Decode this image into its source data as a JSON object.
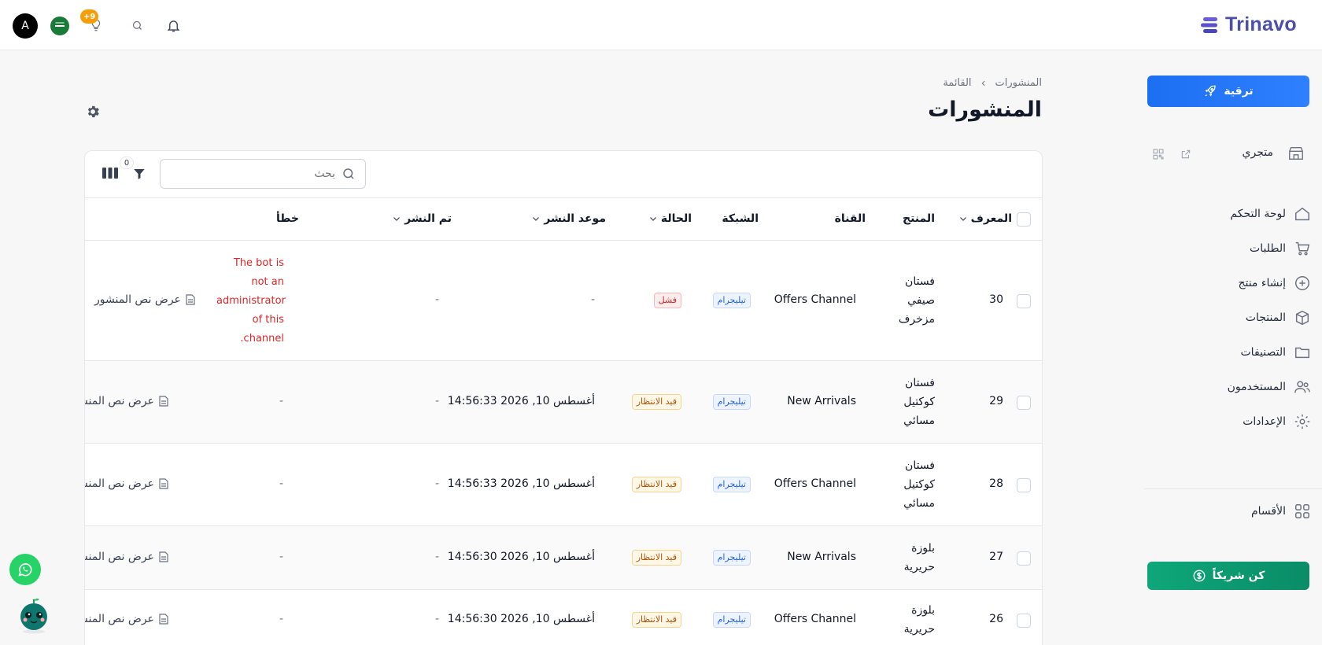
{
  "topbar": {
    "avatar_letter": "A",
    "notif_count": "+9",
    "logo_text": "Trinavo"
  },
  "sidebar": {
    "upgrade_label": "ترقية",
    "store_label": "متجري",
    "items": [
      {
        "label": "لوحة التحكم",
        "icon": "home-icon"
      },
      {
        "label": "الطلبات",
        "icon": "cart-icon"
      },
      {
        "label": "إنشاء منتج",
        "icon": "plus-circle-icon"
      },
      {
        "label": "المنتجات",
        "icon": "box-icon"
      },
      {
        "label": "التصنيفات",
        "icon": "folder-icon"
      },
      {
        "label": "المستخدمون",
        "icon": "users-icon"
      },
      {
        "label": "الإعدادات",
        "icon": "gear-icon"
      }
    ],
    "sections_label": "الأقسام",
    "partner_label": "كن شريكاً"
  },
  "header": {
    "breadcrumb": [
      "المنشورات",
      "القائمة"
    ],
    "title": "المنشورات"
  },
  "toolbar": {
    "search_placeholder": "بحث",
    "filter_count": "0"
  },
  "table": {
    "columns": {
      "id": "المعرف",
      "product": "المنتج",
      "channel": "القناة",
      "network": "الشبكة",
      "status": "الحالة",
      "scheduled": "موعد النشر",
      "published": "تم النشر",
      "error": "خطأ"
    },
    "rows": [
      {
        "id": "30",
        "product": [
          "فستان",
          "صيفي",
          "مزخرف"
        ],
        "channel": "Offers Channel",
        "network": "تيليجرام",
        "status": "فشل",
        "scheduled": "-",
        "published": "-",
        "error": [
          "The bot is",
          "not an",
          "administrator",
          "of this",
          ".channel"
        ],
        "action": "عرض نص المنشور"
      },
      {
        "id": "29",
        "product": [
          "فستان",
          "كوكتيل",
          "مسائي"
        ],
        "channel": "New Arrivals",
        "network": "تيليجرام",
        "status": "قيد الانتظار",
        "scheduled": "أغسطس 10, 2026 14:56:33",
        "published": "-",
        "error": [
          "-"
        ],
        "action": "عرض نص المنشور"
      },
      {
        "id": "28",
        "product": [
          "فستان",
          "كوكتيل",
          "مسائي"
        ],
        "channel": "Offers Channel",
        "network": "تيليجرام",
        "status": "قيد الانتظار",
        "scheduled": "أغسطس 10, 2026 14:56:33",
        "published": "-",
        "error": [
          "-"
        ],
        "action": "عرض نص المنشور"
      },
      {
        "id": "27",
        "product": [
          "بلوزة",
          "حريرية"
        ],
        "channel": "New Arrivals",
        "network": "تيليجرام",
        "status": "قيد الانتظار",
        "scheduled": "أغسطس 10, 2026 14:56:30",
        "published": "-",
        "error": [
          "-"
        ],
        "action": "عرض نص المنشور"
      },
      {
        "id": "26",
        "product": [
          "بلوزة",
          "حريرية"
        ],
        "channel": "Offers Channel",
        "network": "تيليجرام",
        "status": "قيد الانتظار",
        "scheduled": "أغسطس 10, 2026 14:56:30",
        "published": "-",
        "error": [
          "-"
        ],
        "action": "عرض نص المنشور"
      }
    ]
  }
}
